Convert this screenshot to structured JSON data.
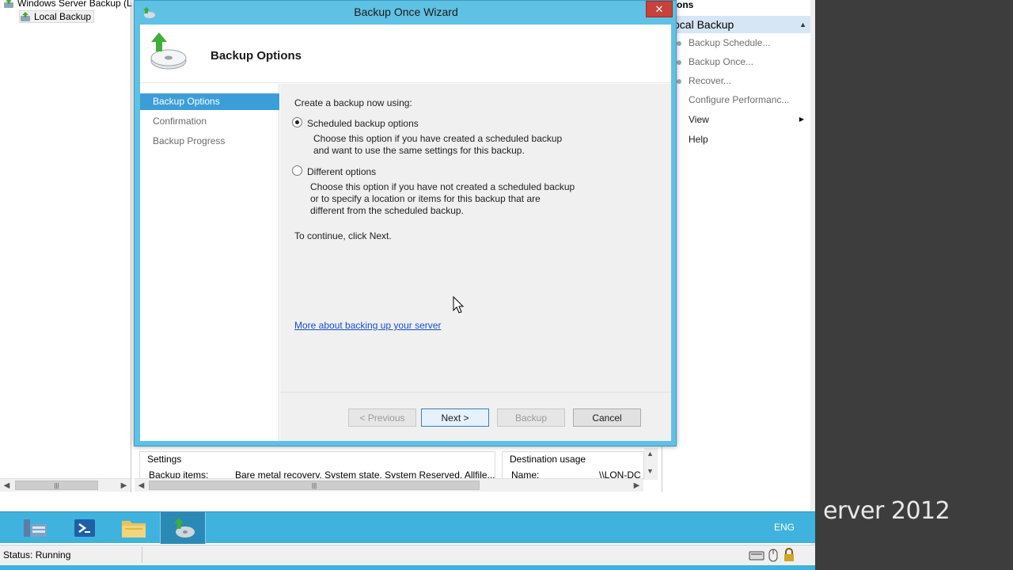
{
  "tree": {
    "root_label": "Windows Server Backup (L",
    "local_backup_label": "Local Backup"
  },
  "center": {
    "settings_title": "Settings",
    "backup_items_label": "Backup items:",
    "backup_items_value": "Bare metal recovery, System state, System Reserved, Allfile...",
    "destination_title": "Destination usage",
    "name_label": "Name:",
    "name_value": "\\\\LON-DC"
  },
  "actions": {
    "header": "ctions",
    "section": "ocal Backup",
    "items": [
      {
        "label": "Backup Schedule..."
      },
      {
        "label": "Backup Once..."
      },
      {
        "label": "Recover..."
      },
      {
        "label": "Configure Performanc..."
      },
      {
        "label": "View"
      },
      {
        "label": "Help"
      }
    ]
  },
  "wizard": {
    "title": "Backup Once Wizard",
    "close": "✕",
    "heading": "Backup Options",
    "nav": [
      "Backup Options",
      "Confirmation",
      "Backup Progress"
    ],
    "prompt": "Create a backup now using:",
    "option_scheduled_label": "Scheduled backup options",
    "option_scheduled_desc_1": "Choose this option if you have created a scheduled backup",
    "option_scheduled_desc_2": "and want to use the same settings for this backup.",
    "option_different_label": "Different options",
    "option_different_desc_1": "Choose this option if you have not created a scheduled backup",
    "option_different_desc_2": "or to specify a location or items for this backup that are",
    "option_different_desc_3": "different from the scheduled backup.",
    "continue_text": "To continue, click Next.",
    "more_link": "More about backing up your server",
    "buttons": {
      "previous": "< Previous",
      "next": "Next >",
      "backup": "Backup",
      "cancel": "Cancel"
    }
  },
  "taskbar": {
    "lang": "ENG"
  },
  "status": {
    "text": "Status: Running"
  },
  "brand": "erver 2012",
  "colors": {
    "taskbar": "#3fb3dd",
    "selection": "#3c9ed8",
    "link": "#1a4ecb",
    "close": "#c7423a"
  }
}
